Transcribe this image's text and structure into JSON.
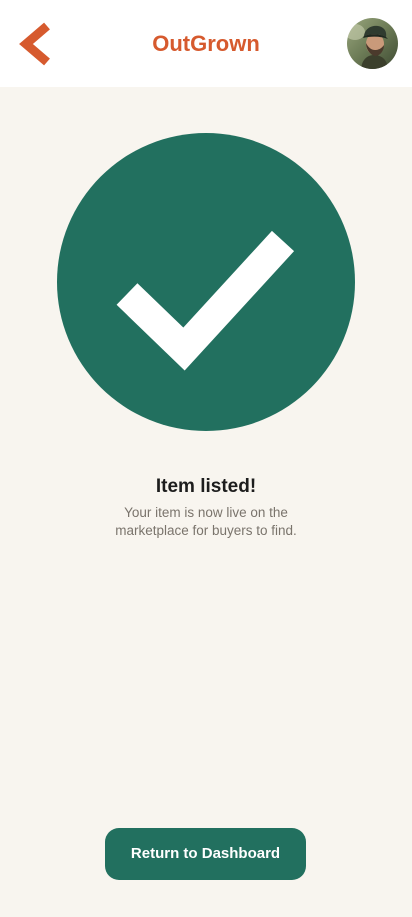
{
  "header": {
    "app_title": "OutGrown",
    "back_icon": "chevron-left-icon",
    "avatar_icon": "user-avatar"
  },
  "confirmation": {
    "icon": "checkmark-icon",
    "title": "Item listed!",
    "message": "Your item is now live on the marketplace for buyers to find."
  },
  "actions": {
    "primary_label": "Return to Dashboard"
  },
  "colors": {
    "brand_orange": "#d65a2e",
    "brand_green": "#22705f",
    "background": "#f8f5ef",
    "header_bg": "#ffffff",
    "text_dark": "#1d1d1d",
    "text_muted": "#7a746c"
  }
}
